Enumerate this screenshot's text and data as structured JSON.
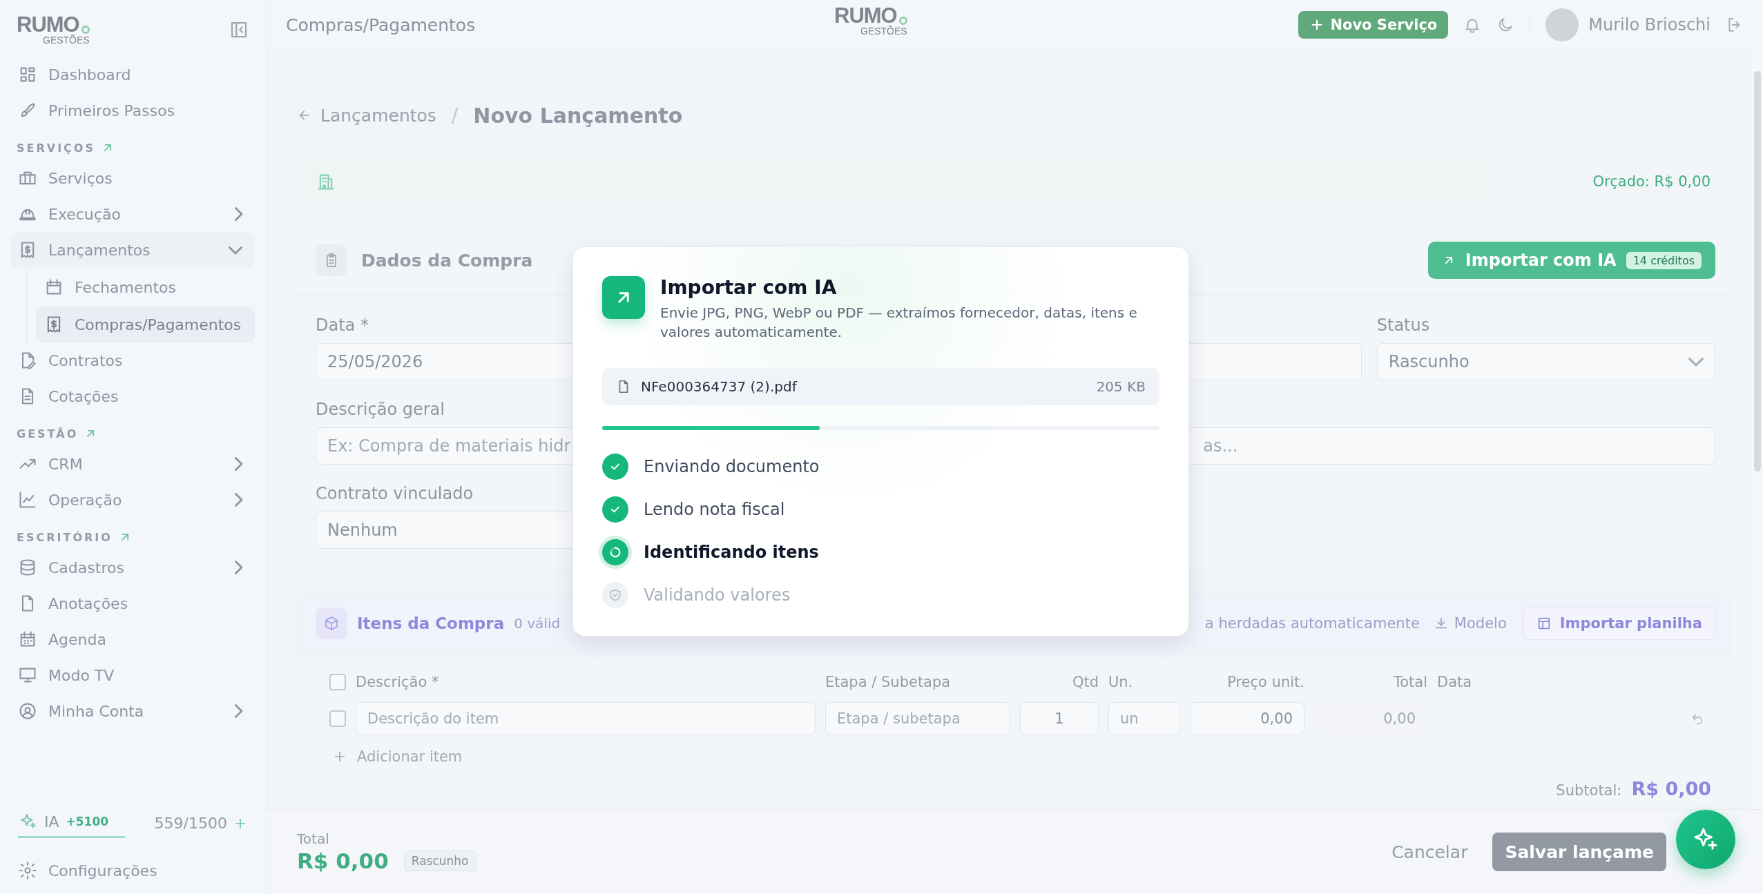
{
  "sidebar": {
    "logo": {
      "word": "RUMO",
      "sub": "GESTÕES"
    },
    "nav": [
      {
        "kind": "item",
        "label": "Dashboard",
        "selected": false
      },
      {
        "kind": "item",
        "label": "Primeiros Passos",
        "selected": false
      },
      {
        "kind": "section",
        "label": "SERVIÇOS"
      },
      {
        "kind": "item",
        "label": "Serviços",
        "selected": false
      },
      {
        "kind": "item",
        "label": "Execução",
        "selected": false,
        "expanded": false
      },
      {
        "kind": "item",
        "label": "Lançamentos",
        "selected": false,
        "expanded": true,
        "children": [
          {
            "label": "Fechamentos",
            "selected": false
          },
          {
            "label": "Compras/Pagamentos",
            "selected": true
          }
        ]
      },
      {
        "kind": "item",
        "label": "Contratos",
        "selected": false
      },
      {
        "kind": "item",
        "label": "Cotações",
        "selected": false
      },
      {
        "kind": "section",
        "label": "GESTÃO"
      },
      {
        "kind": "item",
        "label": "CRM",
        "selected": false,
        "expanded": false
      },
      {
        "kind": "item",
        "label": "Operação",
        "selected": false,
        "expanded": false
      },
      {
        "kind": "section",
        "label": "ESCRITÓRIO"
      },
      {
        "kind": "item",
        "label": "Cadastros",
        "selected": false,
        "expanded": false
      },
      {
        "kind": "item",
        "label": "Anotações",
        "selected": false
      },
      {
        "kind": "item",
        "label": "Agenda",
        "selected": false
      },
      {
        "kind": "item",
        "label": "Modo TV",
        "selected": false
      },
      {
        "kind": "item",
        "label": "Minha Conta",
        "selected": false,
        "expanded": false
      }
    ],
    "ia": {
      "label": "IA",
      "bonus": "+5100",
      "usage": "559/1500"
    },
    "settings": "Configurações"
  },
  "header": {
    "title": "Compras/Pagamentos",
    "logo": {
      "word": "RUMO",
      "sub": "GESTÕES"
    },
    "new_service": "Novo Serviço",
    "user": "Murilo Brioschi"
  },
  "breadcrumb": {
    "back": "Lançamentos",
    "separator": "/",
    "current": "Novo Lançamento"
  },
  "budget": "Orçado: R$ 0,00",
  "purchase": {
    "title": "Dados da Compra",
    "import_button": {
      "label": "Importar com IA",
      "credits": "14 créditos"
    },
    "date": {
      "label": "Data *",
      "value": "25/05/2026"
    },
    "status": {
      "label": "Status",
      "value": "Rascunho"
    },
    "description": {
      "label": "Descrição geral",
      "placeholder": "Ex: Compra de materiais hidr",
      "placeholder_tail": "as..."
    },
    "contract": {
      "label": "Contrato vinculado",
      "value": "Nenhum"
    }
  },
  "items": {
    "title": "Itens da Compra",
    "count": "0 válid",
    "note": "a herdadas automaticamente",
    "template": "Modelo",
    "import_sheet": "Importar planilha",
    "columns": [
      "Descrição *",
      "Etapa / Subetapa",
      "Qtd",
      "Un.",
      "Preço unit.",
      "Total",
      "Data"
    ],
    "all_checked": false,
    "rows": [
      {
        "checked": false,
        "description": "Descrição do item",
        "stage": "Etapa / subetapa",
        "qty": "1",
        "unit": "un",
        "price": "0,00",
        "total": "0,00"
      }
    ],
    "add": "Adicionar item",
    "subtotal_label": "Subtotal:",
    "subtotal": "R$ 0,00"
  },
  "footer": {
    "total_label": "Total",
    "total": "R$ 0,00",
    "status": "Rascunho",
    "cancel": "Cancelar",
    "save": "Salvar lançame"
  },
  "modal": {
    "title": "Importar com IA",
    "description": "Envie JPG, PNG, WebP ou PDF — extraímos fornecedor, datas, itens e valores automaticamente.",
    "file": {
      "name": "NFe000364737 (2).pdf",
      "size": "205 KB"
    },
    "level": 0.39,
    "steps": [
      {
        "label": "Enviando documento",
        "done": true,
        "active": false
      },
      {
        "label": "Lendo nota fiscal",
        "done": true,
        "active": false
      },
      {
        "label": "Identificando itens",
        "done": false,
        "active": true
      },
      {
        "label": "Validando valores",
        "done": false,
        "active": false
      }
    ]
  }
}
